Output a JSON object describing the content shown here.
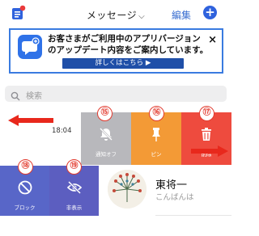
{
  "header": {
    "title": "メッセージ",
    "edit_label": "編集",
    "compose_label": "+"
  },
  "banner": {
    "line1": "お客さまがご利用中のアプリバージョン",
    "line2": "のアップデート内容をご案内しています。",
    "button_label": "詳しくはこちら ▶",
    "close_label": "×"
  },
  "search": {
    "placeholder": "検索"
  },
  "conversation_top": {
    "time": "18:04"
  },
  "swipe_actions_right": [
    {
      "badge": "⑮",
      "label": "通知オフ",
      "icon": "mute-icon",
      "color": "#b8b8bc"
    },
    {
      "badge": "⑯",
      "label": "ピン",
      "icon": "pin-icon",
      "color": "#f39a36"
    },
    {
      "badge": "⑰",
      "label": "削除",
      "icon": "trash-icon",
      "color": "#ee4b3e"
    }
  ],
  "swipe_actions_left": [
    {
      "badge": "⑱",
      "label": "ブロック",
      "icon": "block-icon",
      "color": "#5866c8"
    },
    {
      "badge": "⑲",
      "label": "非表示",
      "icon": "hide-icon",
      "color": "#5c5ec0"
    }
  ],
  "conversation_bottom": {
    "name": "東将一",
    "message": "こんばんは"
  },
  "colors": {
    "accent": "#2f62dd",
    "annotation_red": "#e23b2f"
  }
}
